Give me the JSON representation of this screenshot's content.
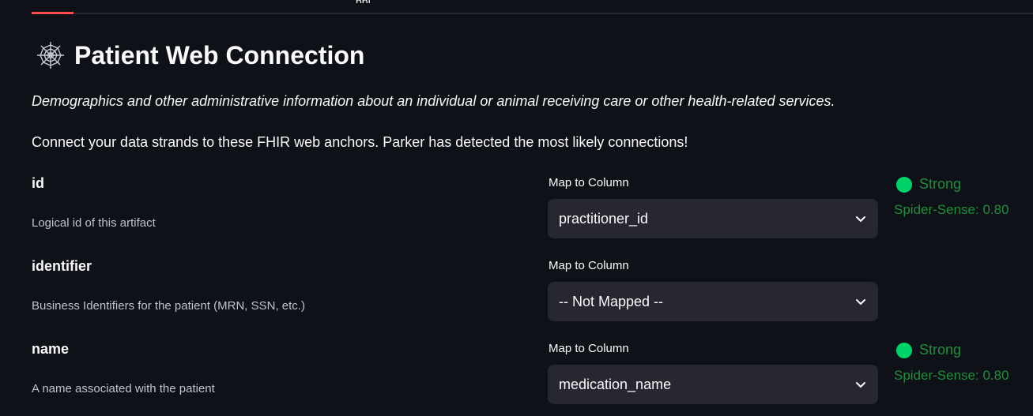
{
  "tabs": {
    "partial_label": "ppi"
  },
  "page": {
    "title": "Patient Web Connection",
    "title_icon": "spider-web-icon",
    "description": "Demographics and other administrative information about an individual or animal receiving care or other health-related services.",
    "intro": "Connect your data strands to these FHIR web anchors. Parker has detected the most likely connections!"
  },
  "colors": {
    "background": "#0e1117",
    "accent": "#ff4b4b",
    "select_bg": "#262730",
    "status_dot": "#00d26a",
    "status_text": "#1f8f3a"
  },
  "fields": [
    {
      "name": "id",
      "description": "Logical id of this artifact",
      "map_label": "Map to Column",
      "selected": "practitioner_id",
      "status": "Strong",
      "sense": "Spider-Sense: 0.80"
    },
    {
      "name": "identifier",
      "description": "Business Identifiers for the patient (MRN, SSN, etc.)",
      "map_label": "Map to Column",
      "selected": "-- Not Mapped --"
    },
    {
      "name": "name",
      "description": "A name associated with the patient",
      "map_label": "Map to Column",
      "selected": "medication_name",
      "status": "Strong",
      "sense": "Spider-Sense: 0.80"
    }
  ]
}
